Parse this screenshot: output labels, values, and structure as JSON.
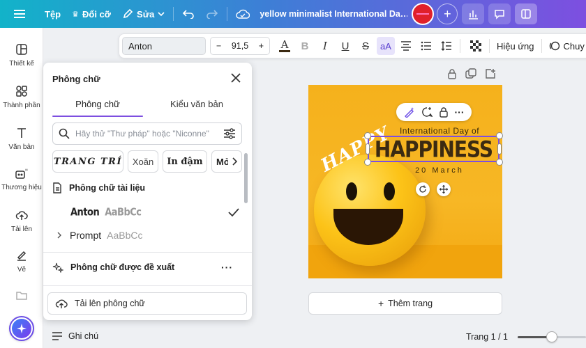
{
  "topbar": {
    "file_label": "Tệp",
    "resize_label": "Đổi cỡ",
    "edit_label": "Sửa",
    "doc_title": "yellow minimalist International Da…",
    "gradient_start": "#12b3c9",
    "gradient_end": "#7d4fe0"
  },
  "rail": {
    "items": [
      {
        "label": "Thiết kế",
        "icon": "layout-icon"
      },
      {
        "label": "Thành phần",
        "icon": "elements-icon"
      },
      {
        "label": "Văn bản",
        "icon": "text-icon"
      },
      {
        "label": "Thương hiệu",
        "icon": "brand-icon"
      },
      {
        "label": "Tải lên",
        "icon": "upload-cloud-icon"
      },
      {
        "label": "Vẽ",
        "icon": "draw-icon"
      }
    ]
  },
  "text_toolbar": {
    "font_name": "Anton",
    "minus": "−",
    "font_size": "91,5",
    "plus": "+",
    "effects_label": "Hiệu ứng",
    "animate_label": "Chuy"
  },
  "font_panel": {
    "title": "Phông chữ",
    "tabs": [
      "Phông chữ",
      "Kiểu văn bản"
    ],
    "active_tab": 0,
    "search_placeholder": "Hãy thử \"Thư pháp\" hoặc \"Niconne\"",
    "chips": [
      "TRANG TRÍ",
      "Xoăn",
      "In đậm",
      "Mở"
    ],
    "doc_fonts_heading": "Phông chữ tài liệu",
    "fonts": [
      {
        "name": "Anton",
        "sample": "AaBbCc",
        "selected": true
      },
      {
        "name": "Prompt",
        "sample": "AaBbCc",
        "selected": false
      }
    ],
    "recommended_heading": "Phông chữ được đề xuất",
    "upload_label": "Tải lên phông chữ"
  },
  "design": {
    "line1": "International Day of",
    "headline": "HAPPINESS",
    "date": "20 March",
    "hand_text": "HAPPY"
  },
  "add_page_label": "Thêm trang",
  "footer": {
    "notes_label": "Ghi chú",
    "page_indicator": "Trang 1 / 1",
    "zoom_fraction": 0.5
  }
}
